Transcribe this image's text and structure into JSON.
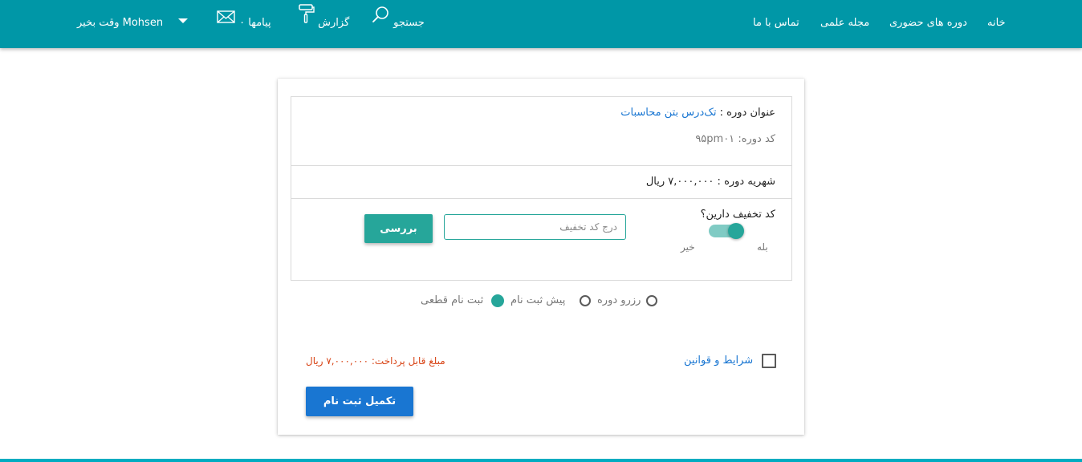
{
  "nav": {
    "home": "خانه",
    "in_person_courses": "دوره های حضوری",
    "journal": "مجله علمی",
    "contact": "تماس با ما",
    "search": "جستجو",
    "report": "گزارش",
    "messages": "پیامها ۰",
    "user_greeting": "Mohsen وقت بخیر"
  },
  "course": {
    "title_label": "عنوان دوره :",
    "title_value": "تک‌درس بتن محاسبات",
    "code_label": "کد دوره:",
    "code_value": "۹۵pm۰۱",
    "fee_text": "شهریه دوره : ۷,۰۰۰,۰۰۰ ریال"
  },
  "discount": {
    "question": "کد تخفیف دارین؟",
    "yes_label": "بله",
    "no_label": "خیر",
    "toggle_on": true,
    "input_value": "",
    "input_placeholder": "درج کد تخفیف",
    "check_button": "بررسی"
  },
  "registration_type": {
    "options": [
      "رزرو دوره",
      "پیش ثبت نام",
      "ثبت نام قطعی"
    ],
    "selected": "پیش ثبت نام"
  },
  "terms": {
    "label": "شرایط و قوانین",
    "checked": false
  },
  "payable": "مبلغ قابل پرداخت: ۷,۰۰۰,۰۰۰ ریال",
  "submit_button": "تکمیل ثبت نام",
  "colors": {
    "header": "#0097a7",
    "accent": "#26a69a",
    "link": "#1976d2",
    "payable": "#d84315",
    "bottom_line": "#00acc1"
  },
  "icons": [
    "search-icon",
    "paint-roller-icon",
    "envelope-icon",
    "caret-down-icon"
  ]
}
